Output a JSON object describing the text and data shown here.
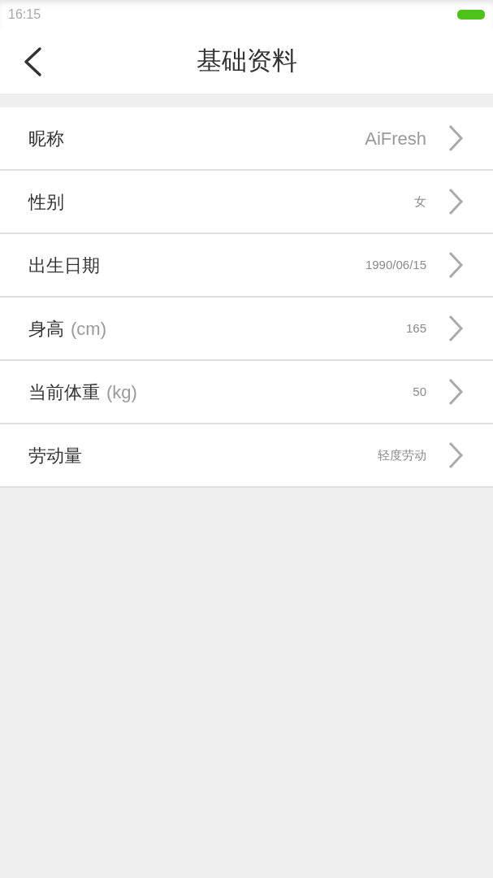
{
  "status_bar": {
    "time": "16:15"
  },
  "header": {
    "title": "基础资料"
  },
  "rows": [
    {
      "label": "昵称",
      "value": "AiFresh",
      "kind": "large"
    },
    {
      "label": "性别",
      "value": "女",
      "kind": "small"
    },
    {
      "label": "出生日期",
      "value": "1990/06/15",
      "kind": "small"
    },
    {
      "label": "身高",
      "unit": "(cm)",
      "value": "165",
      "kind": "small"
    },
    {
      "label": "当前体重",
      "unit": "(kg)",
      "value": "50",
      "kind": "small"
    },
    {
      "label": "劳动量",
      "value": "轻度劳动",
      "kind": "small"
    }
  ]
}
